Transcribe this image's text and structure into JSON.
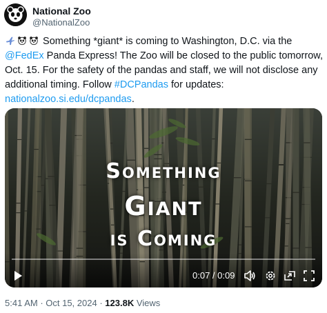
{
  "account": {
    "name": "National Zoo",
    "handle": "@NationalZoo"
  },
  "tweet": {
    "text_1": " Something *giant* is coming to Washington, D.C. via the ",
    "mention": "@FedEx",
    "text_2": " Panda Express! The Zoo will be closed to the public tomorrow, Oct. 15. For the safety of the pandas and staff, we will not disclose any additional timing. Follow ",
    "hashtag": "#DCPandas",
    "text_3": " for updates: ",
    "url": "nationalzoo.si.edu/dcpandas",
    "text_4": ".",
    "leading_icons": [
      "airplane-icon",
      "panda-icon",
      "panda-icon"
    ]
  },
  "video": {
    "line1": "Something",
    "line2": "Giant",
    "line3": "is Coming",
    "time": "0:07 / 0:09",
    "progress": 0.0
  },
  "meta": {
    "time": "5:41 AM",
    "sep1": " · ",
    "date": "Oct 15, 2024",
    "sep2": " · ",
    "views": "123.8K",
    "views_label": " Views"
  },
  "colors": {
    "link": "#1d9bf0",
    "muted": "#536471",
    "text": "#0f1419"
  }
}
